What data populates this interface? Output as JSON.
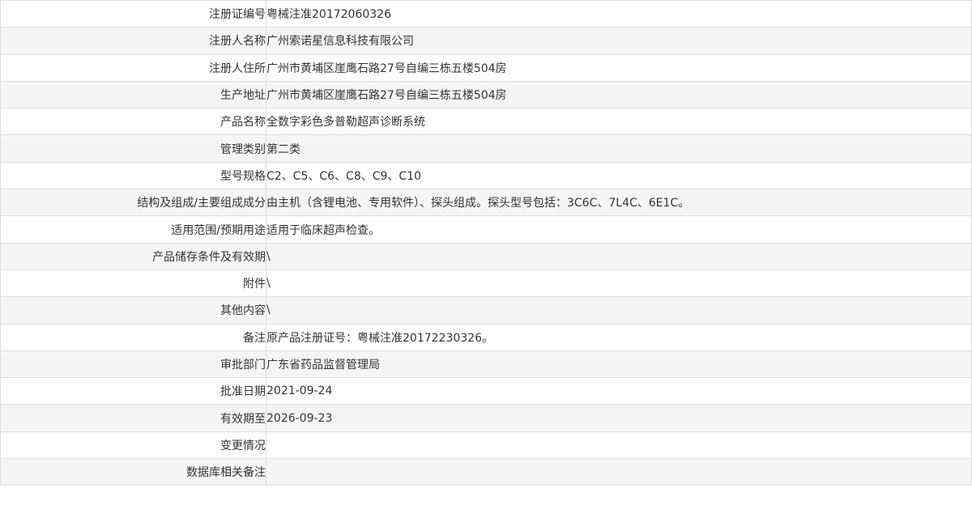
{
  "rows": [
    {
      "label": "注册证编号",
      "value": "粤械注准20172060326"
    },
    {
      "label": "注册人名称",
      "value": "广州索诺星信息科技有限公司"
    },
    {
      "label": "注册人住所",
      "value": "广州市黄埔区崖鹰石路27号自编三栋五楼504房"
    },
    {
      "label": "生产地址",
      "value": "广州市黄埔区崖鹰石路27号自编三栋五楼504房"
    },
    {
      "label": "产品名称",
      "value": "全数字彩色多普勒超声诊断系统"
    },
    {
      "label": "管理类别",
      "value": "第二类"
    },
    {
      "label": "型号规格",
      "value": "C2、C5、C6、C8、C9、C10"
    },
    {
      "label": "结构及组成/主要组成成分",
      "value": "由主机（含锂电池、专用软件）、探头组成。探头型号包括：3C6C、7L4C、6E1C。"
    },
    {
      "label": "适用范围/预期用途",
      "value": "适用于临床超声检查。"
    },
    {
      "label": "产品储存条件及有效期",
      "value": "\\"
    },
    {
      "label": "附件",
      "value": "\\"
    },
    {
      "label": "其他内容",
      "value": "\\"
    },
    {
      "label": "备注",
      "value": "原产品注册证号：粤械注准20172230326。"
    },
    {
      "label": "审批部门",
      "value": "广东省药品监督管理局"
    },
    {
      "label": "批准日期",
      "value": "2021-09-24"
    },
    {
      "label": "有效期至",
      "value": "2026-09-23"
    },
    {
      "label": "变更情况",
      "value": ""
    },
    {
      "label": "数据库相关备注",
      "value": ""
    }
  ]
}
